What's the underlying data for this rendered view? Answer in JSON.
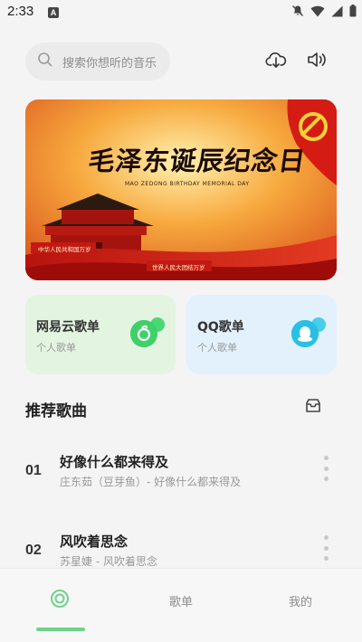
{
  "status_bar": {
    "time": "2:33",
    "notification_icon_letter": "A",
    "icons": [
      "bell-off-icon",
      "wifi-icon",
      "signal-icon",
      "battery-icon"
    ]
  },
  "search": {
    "placeholder": "搜索你想听的音乐"
  },
  "header_icons": [
    "download-cloud-icon",
    "speaker-icon"
  ],
  "banner": {
    "title": "毛泽东诞辰纪念日",
    "subtitle": "MAO ZEDONG BIRTHDAY MEMORIAL DAY",
    "left_sign": "中华人民共和国万岁",
    "right_sign": "世界人民大团结万岁"
  },
  "cards": [
    {
      "title": "网易云歌单",
      "subtitle": "个人歌单",
      "icon": "netease-music-icon",
      "color": "#3fcf6b"
    },
    {
      "title": "QQ歌单",
      "subtitle": "个人歌单",
      "icon": "qq-music-icon",
      "color": "#29c0e6"
    }
  ],
  "section": {
    "title": "推荐歌曲"
  },
  "songs": [
    {
      "index": "01",
      "title": "好像什么都来得及",
      "subtitle": "庄东茹（豆芽鱼）- 好像什么都来得及"
    },
    {
      "index": "02",
      "title": "风吹着思念",
      "subtitle": "苏星婕 - 风吹着思念"
    }
  ],
  "bottom_nav": {
    "home_icon": "home-circle-icon",
    "playlist_label": "歌单",
    "mine_label": "我的",
    "accent": "#6fd28a"
  }
}
